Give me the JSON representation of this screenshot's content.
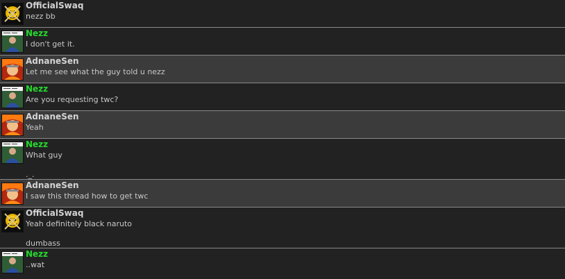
{
  "messages": [
    {
      "user": "OfficialSwaq",
      "text": "nezz bb",
      "avatar": "gold-skull-avatar"
    },
    {
      "user": "Nezz",
      "text": "I don't get it.",
      "avatar": "man-photo-avatar"
    },
    {
      "user": "AdnaneSen",
      "text": "Let me see what the guy told u nezz",
      "avatar": "orange-anime-avatar"
    },
    {
      "user": "Nezz",
      "text": "Are you requesting twc?",
      "avatar": "man-photo-avatar"
    },
    {
      "user": "AdnaneSen",
      "text": "Yeah",
      "avatar": "orange-anime-avatar"
    },
    {
      "user": "Nezz",
      "text": "What guy",
      "extra": "._.",
      "avatar": "man-photo-avatar"
    },
    {
      "user": "AdnaneSen",
      "text": "I saw this thread how to get twc",
      "avatar": "orange-anime-avatar"
    },
    {
      "user": "OfficialSwaq",
      "text": "Yeah definitely black naruto",
      "extra": "dumbass",
      "avatar": "gold-skull-avatar"
    },
    {
      "user": "Nezz",
      "text": "..wat",
      "avatar": "man-photo-avatar"
    }
  ],
  "colors": {
    "background": "#222222",
    "alt_row": "#3b3b3b",
    "username": "#d4d4d4",
    "username_highlight": "#24d82c",
    "text": "#c8c8c8",
    "divider": "#8a8a8a"
  }
}
